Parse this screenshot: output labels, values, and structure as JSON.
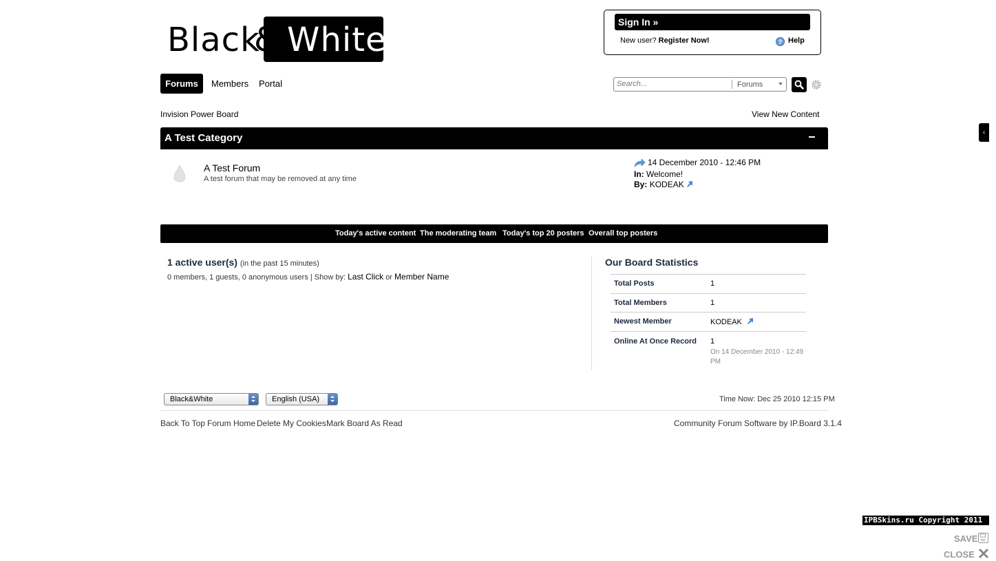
{
  "logo": {
    "word1": "Black",
    "amp": "&",
    "word2": "White"
  },
  "signin": {
    "label": "Sign In »",
    "new_user": "New user?",
    "register": "Register Now!",
    "help_icon": "?",
    "help": "Help"
  },
  "nav": {
    "tabs": [
      {
        "label": "Forums"
      },
      {
        "label": "Members"
      },
      {
        "label": "Portal"
      }
    ]
  },
  "search": {
    "placeholder": "Search...",
    "scope": "Forums"
  },
  "breadcrumb": "Invision Power Board",
  "view_new": "View New Content",
  "category": {
    "title": "A Test Category",
    "forum": {
      "name": "A Test Forum",
      "description": "A test forum that may be removed at any time",
      "last_post": {
        "date": "14 December 2010 - 12:46 PM",
        "in_label": "In:",
        "in_value": "Welcome!",
        "by_label": "By:",
        "by_value": "KODEAK"
      }
    }
  },
  "stats_bar": {
    "links": [
      "Today's active content",
      "The moderating team",
      "Today's top 20 posters",
      "Overall top posters"
    ]
  },
  "active_users": {
    "title": "1 active user(s)",
    "subtitle": "(in the past 15 minutes)",
    "detail": "0 members, 1 guests, 0 anonymous users | Show by:",
    "sort1": "Last Click",
    "or": "or",
    "sort2": "Member Name"
  },
  "board_stats": {
    "title": "Our Board Statistics",
    "rows": [
      {
        "label": "Total Posts",
        "value": "1"
      },
      {
        "label": "Total Members",
        "value": "1"
      },
      {
        "label": "Newest Member",
        "value": "KODEAK"
      },
      {
        "label": "Online At Once Record",
        "value": "1",
        "sub": "On 14 December 2010 - 12:49 PM"
      }
    ]
  },
  "footer": {
    "skin_select": "Black&White",
    "lang_select": "English (USA)",
    "time_now": "Time Now: Dec 25 2010 12:15 PM",
    "links": [
      "Back To Top",
      "Forum Home",
      "Delete My Cookies",
      "Mark Board As Read"
    ],
    "powered": "Community Forum Software by IP.Board 3.1.4"
  },
  "overlay": {
    "copyright": "IPBSkins.ru Copyright 2011",
    "save": "SAVE",
    "close": "CLOSE",
    "side_tab": "‹"
  }
}
